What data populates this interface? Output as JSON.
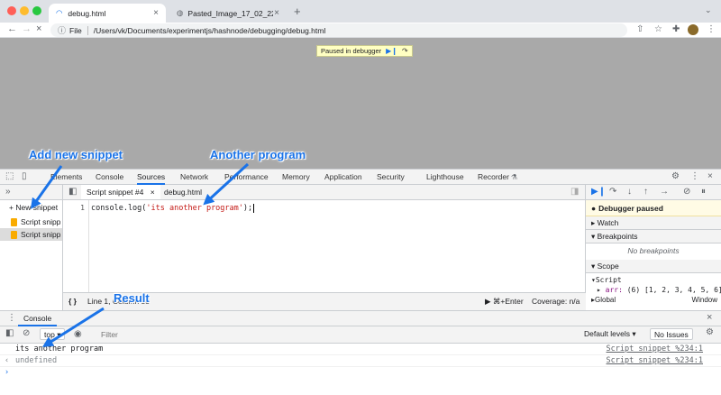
{
  "browser": {
    "tabs": [
      {
        "title": "debug.html",
        "active": true
      },
      {
        "title": "Pasted_Image_17_02_22__1...",
        "active": false
      }
    ],
    "new_tab_glyph": "+",
    "address": {
      "scheme_label": "File",
      "url": "/Users/vk/Documents/experimentjs/hashnode/debugging/debug.html"
    }
  },
  "viewport": {
    "paused_label": "Paused in debugger"
  },
  "annotations": {
    "add_snippet": "Add new snippet",
    "another_program": "Another program",
    "result": "Result"
  },
  "devtools": {
    "tabs": [
      "Elements",
      "Console",
      "Sources",
      "Network",
      "Performance",
      "Memory",
      "Application",
      "Security",
      "Lighthouse",
      "Recorder"
    ],
    "active_tab": "Sources"
  },
  "navigator": {
    "new_snippet_label": "+ New snippet",
    "snippets": [
      "Script snipp",
      "Script snipp"
    ]
  },
  "editor": {
    "tabs": [
      "Script snippet #4",
      "debug.html"
    ],
    "line_numbers": [
      "1"
    ],
    "code": {
      "prefix": "console.log(",
      "string": "'its another program'",
      "suffix": ");"
    },
    "status": {
      "position": "Line 1, Column 35",
      "run_hint": "▶ ⌘+Enter",
      "coverage": "Coverage: n/a"
    }
  },
  "debugger": {
    "paused_banner": "Debugger paused",
    "sections": {
      "watch": "Watch",
      "breakpoints": "Breakpoints",
      "scope": "Scope"
    },
    "no_breakpoints": "No breakpoints",
    "scope": {
      "group": "Script",
      "arr_name": "arr:",
      "arr_value": "(6) [1, 2, 3, 4, 5, 6]",
      "global_name": "Global",
      "global_value": "Window"
    }
  },
  "console": {
    "drawer_tab": "Console",
    "context": "top",
    "filter_placeholder": "Filter",
    "levels": "Default levels ▾",
    "issues": "No Issues",
    "lines": [
      {
        "prefix": "",
        "text": "its another program",
        "source": "Script snippet %234:1"
      },
      {
        "prefix": "‹",
        "text": "undefined",
        "source": "Script snippet %234:1"
      },
      {
        "prefix": "›",
        "text": "",
        "source": ""
      }
    ]
  },
  "colors": {
    "accent": "#1a73e8",
    "paused_bg": "#ffffc2",
    "viewport_bg": "#a9a9a9"
  }
}
